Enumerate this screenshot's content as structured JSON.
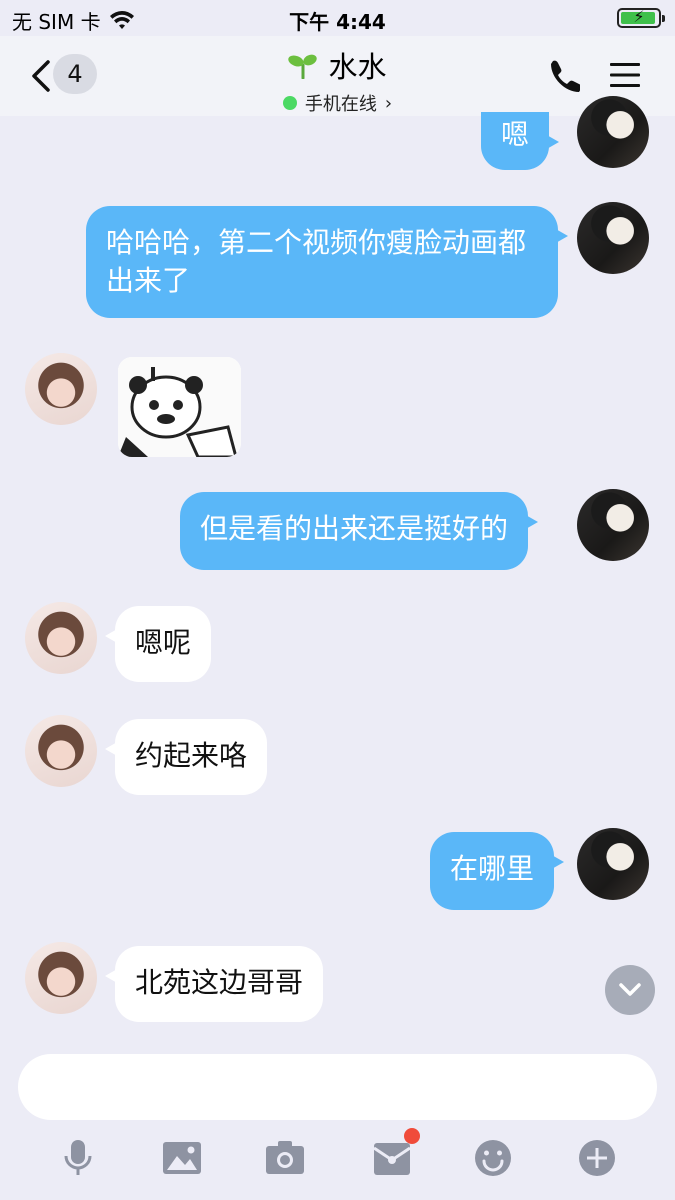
{
  "status_bar": {
    "carrier": "无 SIM 卡",
    "time": "下午 4:44"
  },
  "nav": {
    "unread_count": "4",
    "contact_name": "水水",
    "status": "手机在线"
  },
  "messages": [
    {
      "side": "out",
      "text": "嗯"
    },
    {
      "side": "out",
      "text": "哈哈哈，第二个视频你瘦脸动画都出来了"
    },
    {
      "side": "in",
      "type": "sticker"
    },
    {
      "side": "out",
      "text": "但是看的出来还是挺好的"
    },
    {
      "side": "in",
      "text": "嗯呢"
    },
    {
      "side": "in",
      "text": "约起来咯"
    },
    {
      "side": "out",
      "text": "在哪里"
    },
    {
      "side": "in",
      "text": "北苑这边哥哥"
    }
  ],
  "toolbar": {
    "icons": [
      "microphone-icon",
      "image-icon",
      "camera-icon",
      "red-packet-icon",
      "emoji-icon",
      "plus-icon"
    ],
    "red_packet_has_notification": true
  },
  "colors": {
    "outgoing_bubble": "#5ab7f8",
    "incoming_bubble": "#ffffff",
    "background": "#ececf6",
    "online": "#4cd964",
    "notification": "#f04b3a"
  }
}
